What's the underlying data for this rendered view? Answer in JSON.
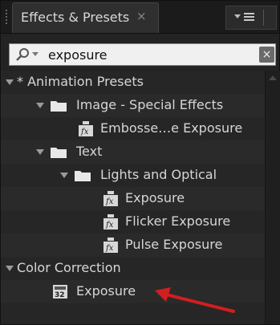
{
  "panel": {
    "tab_label": "Effects & Presets",
    "tab_close": "×"
  },
  "search": {
    "value": "exposure",
    "clear_label": "×"
  },
  "tree": {
    "items": [
      {
        "label": "* Animation Presets",
        "kind": "category",
        "expanded": true
      },
      {
        "label": "Image - Special Effects",
        "kind": "folder",
        "expanded": true
      },
      {
        "label": "Embosse…e Exposure",
        "kind": "preset"
      },
      {
        "label": "Text",
        "kind": "folder",
        "expanded": true
      },
      {
        "label": "Lights and Optical",
        "kind": "folder",
        "expanded": true
      },
      {
        "label": "Exposure",
        "kind": "preset"
      },
      {
        "label": "Flicker Exposure",
        "kind": "preset"
      },
      {
        "label": "Pulse Exposure",
        "kind": "preset"
      },
      {
        "label": "Color Correction",
        "kind": "category",
        "expanded": true
      },
      {
        "label": "Exposure",
        "kind": "effect-32bit"
      }
    ]
  },
  "colors": {
    "panel_bg": "#232323",
    "text": "#d6d6d6",
    "annotation_arrow": "#d21e1e"
  },
  "icons": {
    "search": "magnifier-icon",
    "folder": "folder-icon",
    "preset": "animation-preset-icon",
    "effect": "32bit-effect-icon",
    "panel_menu": "panel-menu-icon"
  }
}
